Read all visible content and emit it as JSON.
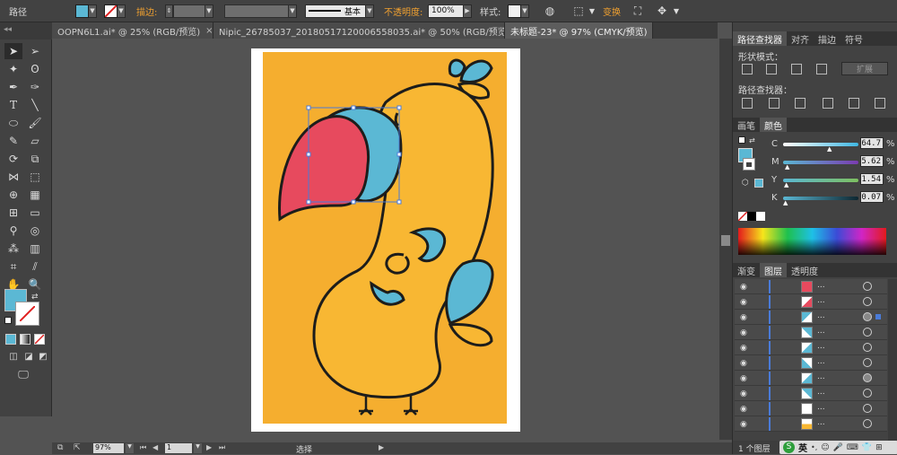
{
  "controlbar": {
    "path_label": "路径",
    "stroke_label": "描边:",
    "stroke_style": "基本",
    "opacity_label": "不透明度:",
    "opacity_value": "100%",
    "style_label": "样式:",
    "transform_label": "变换",
    "fill_color": "#5bb8d4"
  },
  "tabs": [
    {
      "label": "OOPN6L1.ai* @ 25% (RGB/预览)"
    },
    {
      "label": "Nipic_26785037_20180517120006558035.ai* @ 50% (RGB/预览)"
    },
    {
      "label": "未标题-23* @ 97% (CMYK/预览)"
    }
  ],
  "status": {
    "zoom": "97%",
    "artboard_num": "1",
    "tool_label": "选择"
  },
  "pathfinder": {
    "tabs": [
      "路径查找器",
      "对齐",
      "描边",
      "符号"
    ],
    "shape_modes_label": "形状模式：",
    "expand_label": "扩展",
    "pathfinders_label": "路径查找器："
  },
  "color_panel": {
    "tabs": [
      "画笔",
      "颜色"
    ],
    "channels": [
      {
        "name": "C",
        "value": "64.7"
      },
      {
        "name": "M",
        "value": "5.62"
      },
      {
        "name": "Y",
        "value": "1.54"
      },
      {
        "name": "K",
        "value": "0.07"
      }
    ],
    "percent_sign": "%"
  },
  "layers_panel": {
    "tabs": [
      "渐变",
      "图层",
      "透明度"
    ],
    "row_name": "...",
    "footer": "1 个图层"
  },
  "taskbar": {
    "ime_label": "英"
  },
  "colors": {
    "artwork_bg": "#f5ae2f",
    "bird_body": "#f8b733",
    "bird_blue": "#5bb8d4",
    "bird_red": "#e74a5e",
    "outline": "#1d1d1b"
  }
}
